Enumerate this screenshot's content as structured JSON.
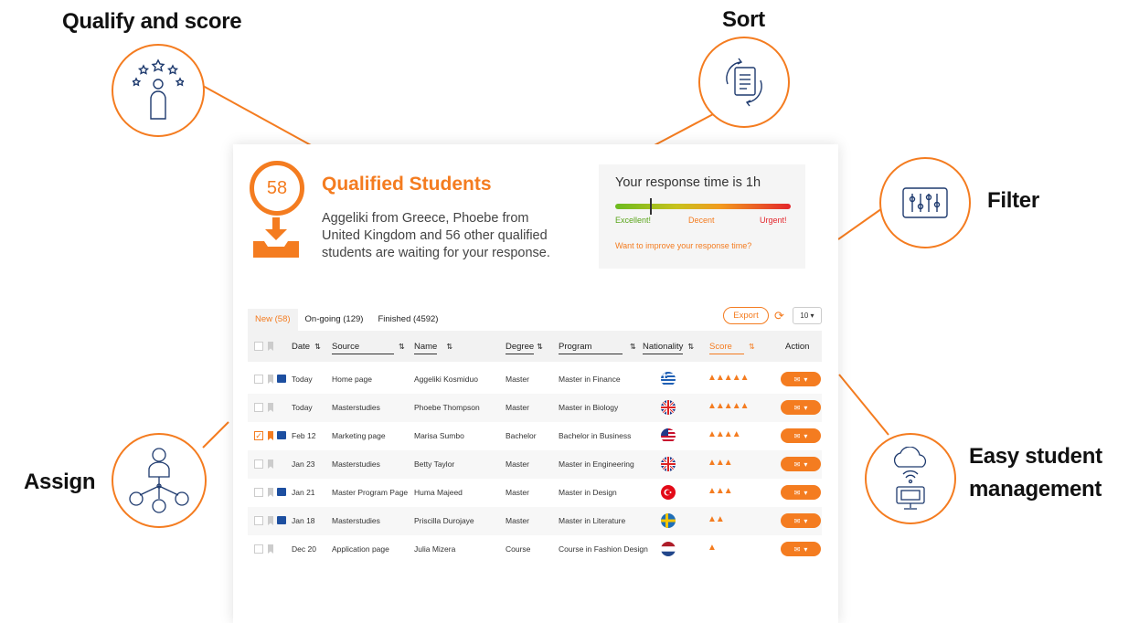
{
  "callouts": {
    "qualify": "Qualify and score",
    "sort": "Sort",
    "filter": "Filter",
    "assign": "Assign",
    "management_line1": "Easy student",
    "management_line2": "management"
  },
  "summary": {
    "count": "58",
    "title": "Qualified Students",
    "text": "Aggeliki from Greece, Phoebe from United Kingdom and 56 other qualified students are waiting for your response."
  },
  "response": {
    "title": "Your response time is 1h",
    "excellent": "Excellent!",
    "decent": "Decent",
    "urgent": "Urgent!",
    "link": "Want to improve your response time?"
  },
  "tabs": [
    "New (58)",
    "On-going  (129)",
    "Finished (4592)"
  ],
  "toolbar": {
    "export": "Export",
    "per_page": "10 ▾"
  },
  "columns": {
    "date": "Date",
    "source": "Source",
    "name": "Name",
    "degree": "Degree",
    "program": "Program",
    "nationality": "Nationality",
    "score": "Score",
    "action": "Action"
  },
  "rows": [
    {
      "date": "Today",
      "source": "Home page",
      "name": "Aggeliki Kosmiduo",
      "degree": "Master",
      "program": "Master in Finance",
      "nationality": "greece",
      "score": 5,
      "checked": false,
      "bookmarked": false,
      "message": true
    },
    {
      "date": "Today",
      "source": "Masterstudies",
      "name": "Phoebe Thompson",
      "degree": "Master",
      "program": "Master in Biology",
      "nationality": "uk",
      "score": 5,
      "checked": false,
      "bookmarked": false,
      "message": false
    },
    {
      "date": "Feb 12",
      "source": "Marketing page",
      "name": "Marisa Sumbo",
      "degree": "Bachelor",
      "program": "Bachelor in Business",
      "nationality": "usa",
      "score": 4,
      "checked": true,
      "bookmarked": true,
      "message": true
    },
    {
      "date": "Jan 23",
      "source": "Masterstudies",
      "name": "Betty Taylor",
      "degree": "Master",
      "program": "Master in Engineering",
      "nationality": "uk",
      "score": 3,
      "checked": false,
      "bookmarked": false,
      "message": false
    },
    {
      "date": "Jan 21",
      "source": "Master Program Page",
      "name": "Huma Majeed",
      "degree": "Master",
      "program": "Master in Design",
      "nationality": "turkey",
      "score": 3,
      "checked": false,
      "bookmarked": false,
      "message": true
    },
    {
      "date": "Jan 18",
      "source": "Masterstudies",
      "name": "Priscilla Durojaye",
      "degree": "Master",
      "program": "Master in Literature",
      "nationality": "sweden",
      "score": 2,
      "checked": false,
      "bookmarked": false,
      "message": true
    },
    {
      "date": "Dec 20",
      "source": "Application page",
      "name": "Julia Mizera",
      "degree": "Course",
      "program": "Course in Fashion Design",
      "nationality": "netherlands",
      "score": 1,
      "checked": false,
      "bookmarked": false,
      "message": false
    }
  ],
  "colors": {
    "accent": "#f47c20",
    "message": "#1d4fa0"
  }
}
